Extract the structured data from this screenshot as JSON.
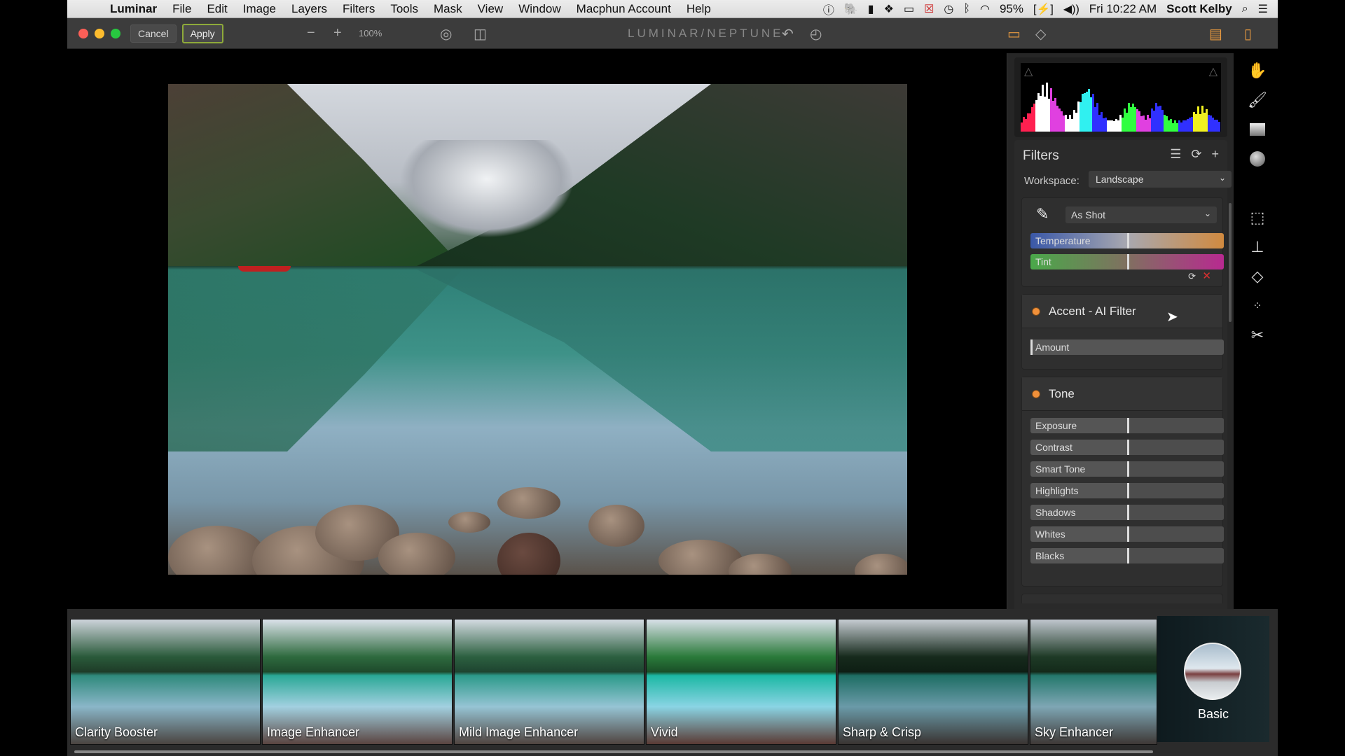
{
  "menubar": {
    "app": "Luminar",
    "items": [
      "File",
      "Edit",
      "Image",
      "Layers",
      "Filters",
      "Tools",
      "Mask",
      "View",
      "Window",
      "Macphun Account",
      "Help"
    ],
    "status_icons": [
      "1password-icon",
      "evernote-icon",
      "app-icon",
      "dropbox-icon",
      "airplay-icon",
      "disabled-icon",
      "time-machine-icon",
      "bluetooth-icon",
      "wifi-icon"
    ],
    "battery": "95%",
    "clock": "Fri 10:22 AM",
    "user": "Scott Kelby"
  },
  "toolbar": {
    "cancel": "Cancel",
    "apply": "Apply",
    "zoom_level": "100%",
    "title": "LUMINAR/NEPTUNE"
  },
  "histogram": {
    "colors": {
      "red": "#ff2050",
      "white": "#ffffff",
      "magenta": "#e040e0",
      "cyan": "#30f0f0",
      "blue": "#3030ff",
      "green": "#30ff40",
      "yellow": "#f0f020"
    }
  },
  "filters": {
    "title": "Filters",
    "workspace_label": "Workspace:",
    "workspace_value": "Landscape",
    "white_balance": {
      "preset": "As Shot",
      "sliders": [
        {
          "label": "Temperature",
          "value": 0
        },
        {
          "label": "Tint",
          "value": 0
        }
      ]
    },
    "accent": {
      "title": "Accent - AI Filter",
      "sliders": [
        {
          "label": "Amount",
          "value": 0
        }
      ]
    },
    "tone": {
      "title": "Tone",
      "sliders": [
        {
          "label": "Exposure",
          "value": 0
        },
        {
          "label": "Contrast",
          "value": 0
        },
        {
          "label": "Smart Tone",
          "value": 0
        },
        {
          "label": "Highlights",
          "value": 0
        },
        {
          "label": "Shadows",
          "value": 0
        },
        {
          "label": "Whites",
          "value": 0
        },
        {
          "label": "Blacks",
          "value": 0
        }
      ]
    },
    "accent_color": "#f0903a"
  },
  "tools": [
    "hand-icon",
    "brush-icon",
    "gradient-icon",
    "radial-icon",
    "crop-icon",
    "clone-stamp-icon",
    "eraser-icon",
    "noise-icon",
    "scissors-icon"
  ],
  "presets": {
    "items": [
      "Clarity Booster",
      "Image Enhancer",
      "Mild Image Enhancer",
      "Vivid",
      "Sharp & Crisp",
      "Sky Enhancer"
    ],
    "category": "Basic"
  }
}
